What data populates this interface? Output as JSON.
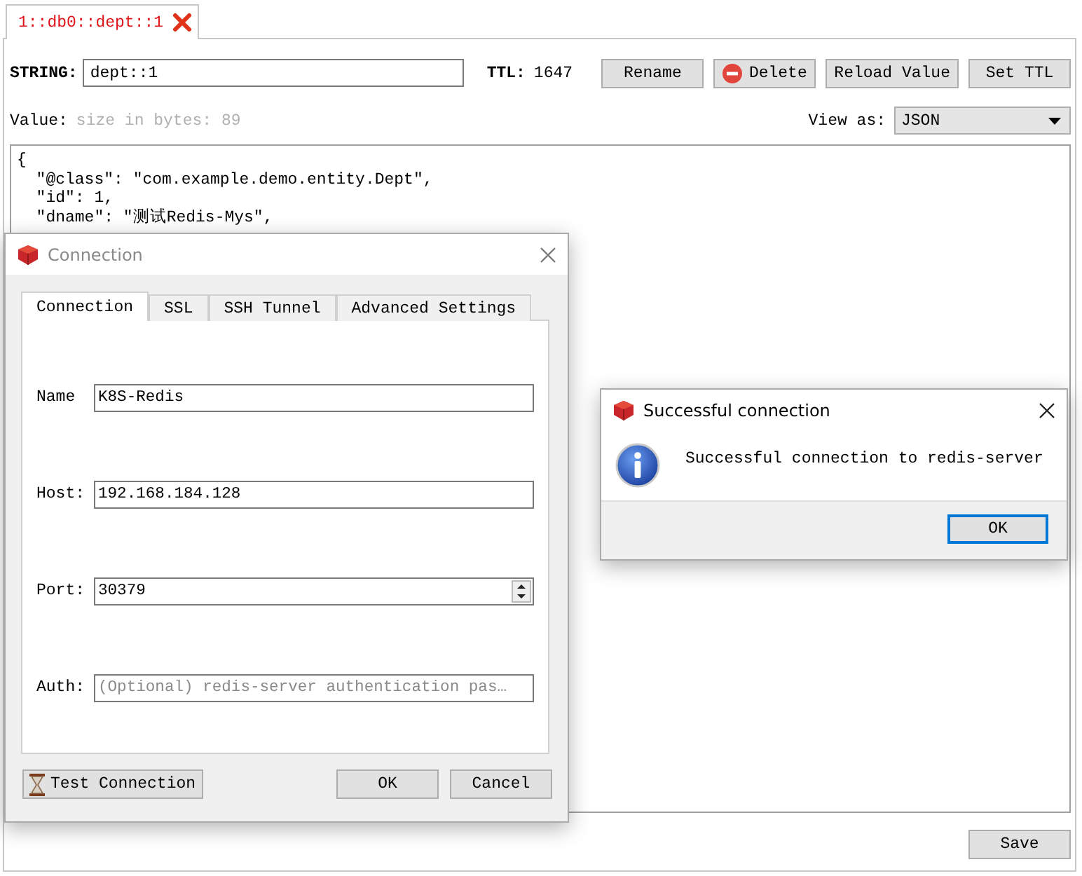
{
  "tabs": [
    {
      "label": "1::db0::dept::1",
      "selected": true
    }
  ],
  "key": {
    "type_label": "STRING:",
    "name": "dept::1",
    "ttl_label": "TTL:",
    "ttl": "1647"
  },
  "key_actions": [
    {
      "label": "Rename",
      "kind": "plain"
    },
    {
      "label": "Delete",
      "kind": "delete"
    },
    {
      "label": "Reload Value",
      "kind": "plain"
    },
    {
      "label": "Set TTL",
      "kind": "plain"
    }
  ],
  "value": {
    "label": "Value:",
    "size": "size in bytes: 89",
    "view_as_label": "View as:",
    "view_as": "JSON",
    "lines": [
      "{",
      "  \"@class\": \"com.example.demo.entity.Dept\",",
      "  \"id\": 1,",
      "  \"dname\": \"测试Redis-Mys\","
    ]
  },
  "save_button": "Save",
  "connection_dialog": {
    "title": "Connection",
    "tabs": [
      {
        "label": "Connection",
        "selected": true
      },
      {
        "label": "SSL",
        "selected": false
      },
      {
        "label": "SSH Tunnel",
        "selected": false
      },
      {
        "label": "Advanced Settings",
        "selected": false
      }
    ],
    "fields": [
      {
        "label": "Name",
        "kind": "text",
        "value": "K8S-Redis"
      },
      {
        "label": "Host:",
        "kind": "text",
        "value": "192.168.184.128"
      },
      {
        "label": "Port:",
        "kind": "spin",
        "value": "30379"
      },
      {
        "label": "Auth:",
        "kind": "text",
        "placeholder": "(Optional) redis-server authentication pas…"
      }
    ],
    "test_button": "Test Connection",
    "buttons": [
      "OK",
      "Cancel"
    ]
  },
  "message_box": {
    "title": "Successful connection",
    "message": "Successful connection to redis-server",
    "button": "OK"
  }
}
